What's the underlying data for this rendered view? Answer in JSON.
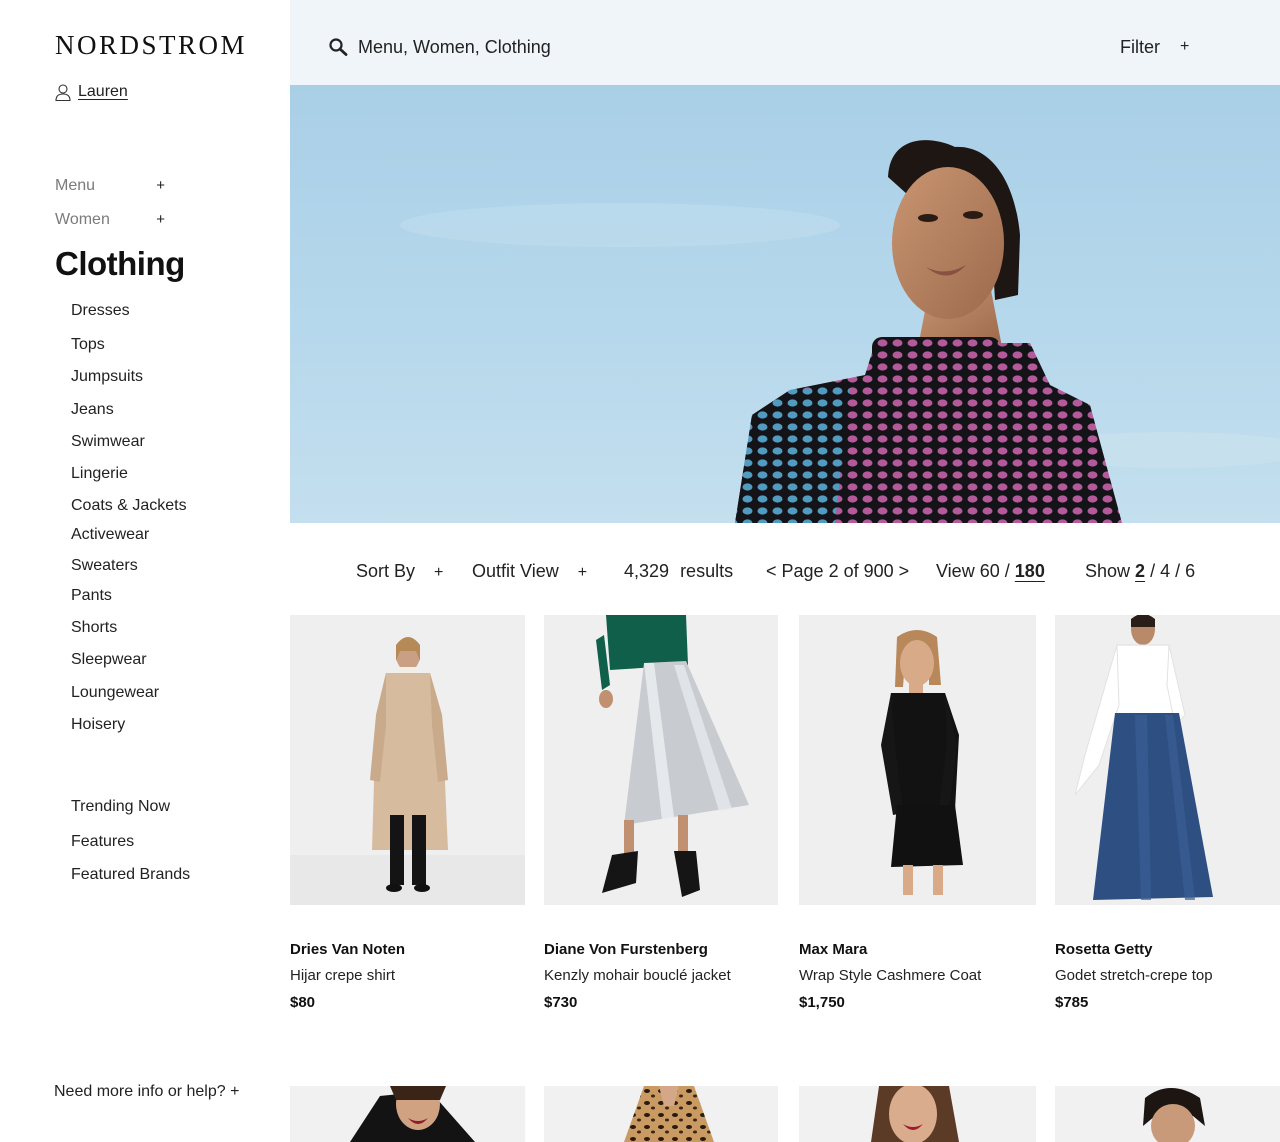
{
  "brand": {
    "logo": "NORDSTROM"
  },
  "user": {
    "name": "Lauren"
  },
  "breadcrumb": [
    {
      "label": "Menu",
      "toggle": "+"
    },
    {
      "label": "Women",
      "toggle": "+"
    }
  ],
  "category": {
    "title": "Clothing"
  },
  "subcategories": [
    "Dresses",
    "Tops",
    "Jumpsuits",
    "Jeans",
    "Swimwear",
    "Lingerie",
    "Coats & Jackets",
    "Activewear",
    "Sweaters",
    "Pants",
    "Shorts",
    "Sleepwear",
    "Loungewear",
    "Hoisery"
  ],
  "extra_links": [
    "Trending Now",
    "Features",
    "Featured Brands"
  ],
  "help": {
    "label": "Need more info or help? +"
  },
  "search": {
    "path": "Menu, Women, Clothing",
    "filter_label": "Filter",
    "filter_toggle": "+"
  },
  "toolbar": {
    "sort_label": "Sort By",
    "sort_toggle": "+",
    "outfit_label": "Outfit View",
    "outfit_toggle": "+",
    "results_count": "4,329",
    "results_label": "results",
    "page_prev": "<",
    "page_text": "Page 2 of 900",
    "page_next": ">",
    "view_label": "View",
    "view_option_a": "60",
    "view_sep": "/",
    "view_option_b": "180",
    "show_label": "Show",
    "show_option_a": "2",
    "show_sep_a": "/",
    "show_option_b": "4",
    "show_sep_b": "/",
    "show_option_c": "6"
  },
  "products": [
    {
      "brand": "Dries Van Noten",
      "name": "Hijar crepe shirt",
      "price": "$80"
    },
    {
      "brand": "Diane Von Furstenberg",
      "name": "Kenzly mohair bouclé jacket",
      "price": "$730"
    },
    {
      "brand": "Max Mara",
      "name": "Wrap Style Cashmere Coat",
      "price": "$1,750"
    },
    {
      "brand": "Rosetta Getty",
      "name": "Godet stretch-crepe top",
      "price": "$785"
    }
  ],
  "colors": {
    "topbar_bg": "#eff5f9",
    "sky": "#b0d3ea",
    "text": "#111111",
    "muted": "#7b7b7b"
  },
  "icons": {
    "user": "user-icon",
    "search": "search-icon"
  }
}
